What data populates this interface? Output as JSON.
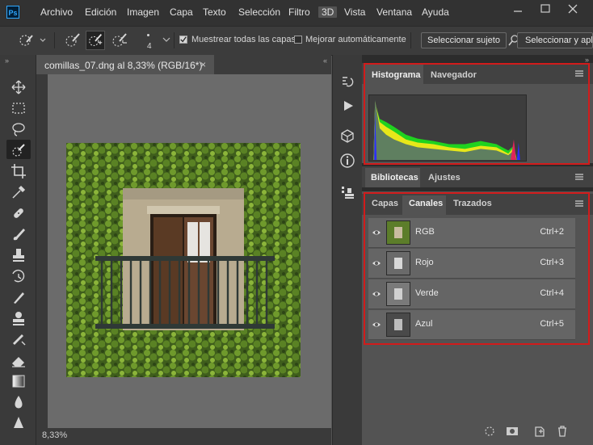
{
  "app": {
    "logo": "Ps"
  },
  "menu": [
    "Archivo",
    "Edición",
    "Imagen",
    "Capa",
    "Texto",
    "Selección",
    "Filtro",
    "3D",
    "Vista",
    "Ventana",
    "Ayuda"
  ],
  "options": {
    "brush_size": "4",
    "sample_all_layers": "Muestrear todas las capas",
    "auto_enhance": "Mejorar automáticamente",
    "select_subject": "Seleccionar sujeto",
    "select_and_mask": "Seleccionar y apli"
  },
  "document": {
    "tab_title": "comillas_07.dng al 8,33% (RGB/16*)",
    "close": "×",
    "zoom": "8,33%"
  },
  "panels": {
    "top": {
      "tabs": [
        "Histograma",
        "Navegador"
      ],
      "active": "Histograma"
    },
    "mid": {
      "tabs": [
        "Bibliotecas",
        "Ajustes"
      ],
      "active": "Bibliotecas"
    },
    "bottom": {
      "tabs": [
        "Capas",
        "Canales",
        "Trazados"
      ],
      "active": "Canales"
    }
  },
  "channels": [
    {
      "name": "RGB",
      "shortcut": "Ctrl+2"
    },
    {
      "name": "Rojo",
      "shortcut": "Ctrl+3"
    },
    {
      "name": "Verde",
      "shortcut": "Ctrl+4"
    },
    {
      "name": "Azul",
      "shortcut": "Ctrl+5"
    }
  ],
  "colors": {
    "highlight": "#d21b1b",
    "accent": "#31a8ff"
  }
}
